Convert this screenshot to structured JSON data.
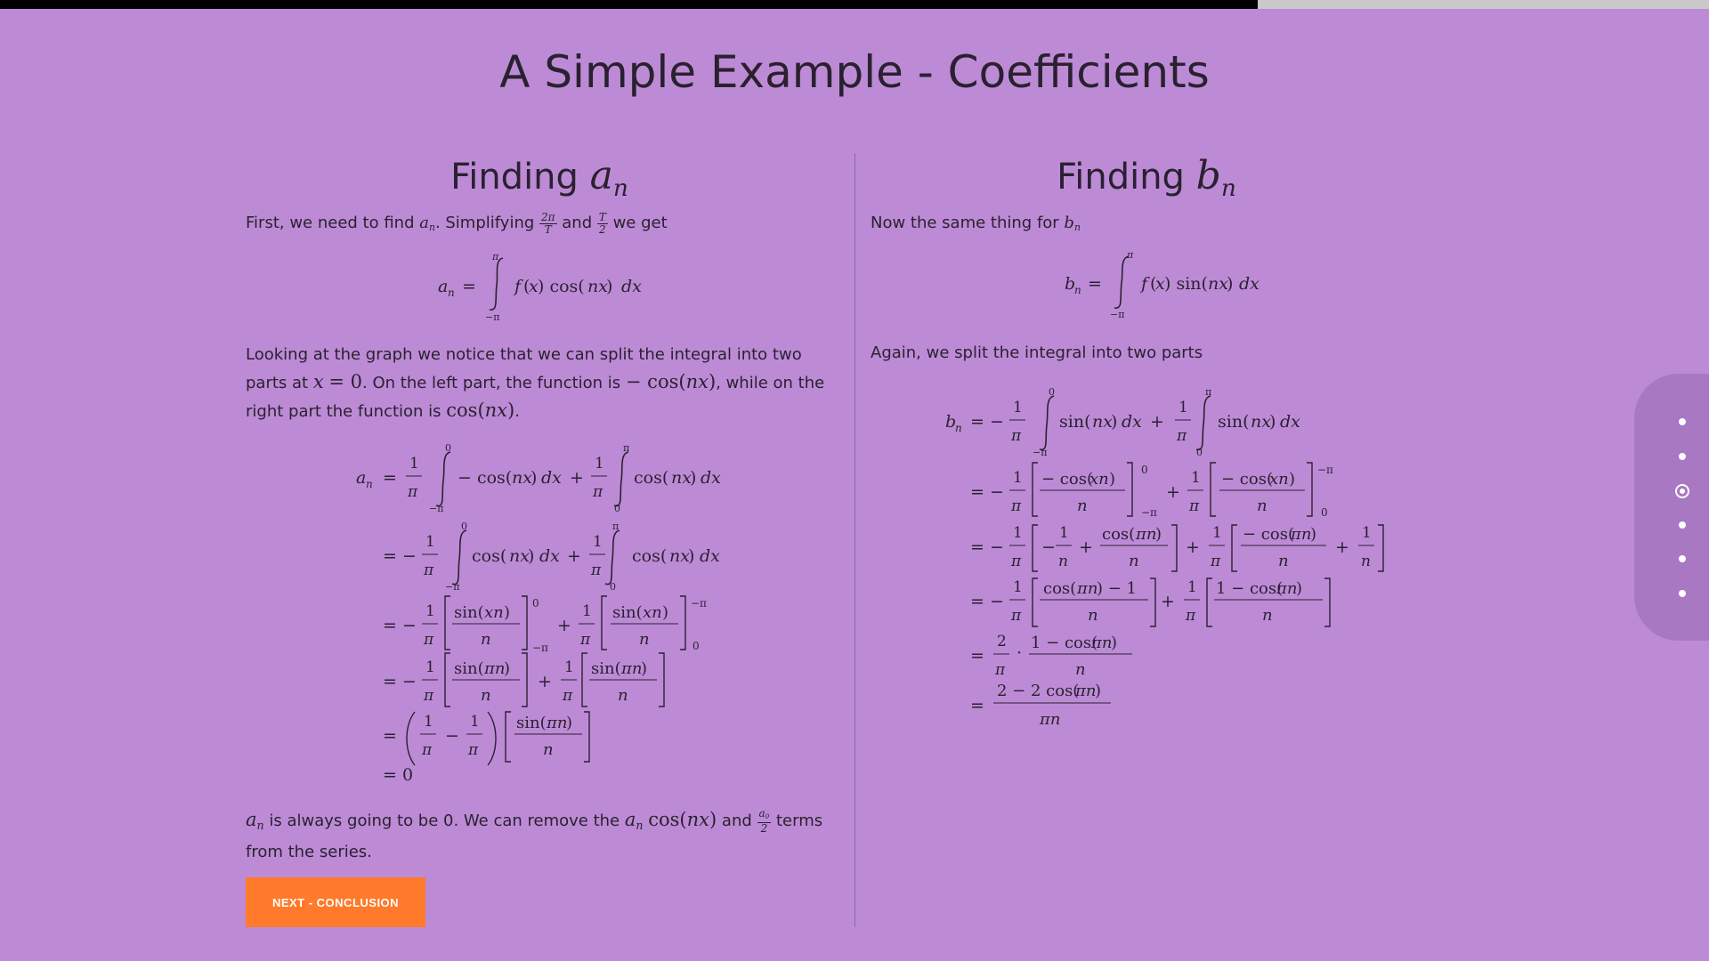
{
  "progress": {
    "fraction": 0.736
  },
  "title": "A Simple Example - Coefficients",
  "left": {
    "heading_prefix": "Finding",
    "heading_symbol": "a",
    "heading_sub": "n",
    "intro": "First, we need to find aₙ. Simplifying 2π/T and T/2 we get",
    "eq1": "aₙ = ∫₋π^π f(x) cos(nx) dx",
    "para2": "Looking at the graph we notice that we can split the integral into two parts at x = 0. On the left part, the function is − cos(nx), while on the right part the function is cos(nx).",
    "derivation": [
      "aₙ = (1/π) ∫₋π⁰ − cos(nx) dx + (1/π) ∫₀^π cos(nx) dx",
      "= −(1/π) ∫₋π⁰ cos(nx) dx + (1/π) ∫₀^π cos(nx) dx",
      "= −(1/π) [ sin(xn)/n ]₋π⁰ + (1/π) [ sin(xn)/n ]₀^−π",
      "= −(1/π) [ sin(πn)/n ] + (1/π) [ sin(πn)/n ]",
      "= ( 1/π − 1/π ) [ sin(πn)/n ]",
      "= 0"
    ],
    "conclusion": "aₙ is always going to be 0. We can remove the aₙ cos(nx) and a₀/2 terms from the series."
  },
  "right": {
    "heading_prefix": "Finding",
    "heading_symbol": "b",
    "heading_sub": "n",
    "intro": "Now the same thing for bₙ",
    "eq1": "bₙ = ∫₋π^π f(x) sin(nx) dx",
    "para2": "Again, we split the integral into two parts",
    "derivation": [
      "bₙ = −(1/π) ∫₋π⁰ sin(nx) dx + (1/π) ∫₀^π sin(nx) dx",
      "= −(1/π) [ − cos(xn)/n ]₋π⁰ + (1/π) [ − cos(xn)/n ]₀^−π",
      "= −(1/π) [ −1/n + cos(πn)/n ] + (1/π) [ − cos(πn)/n + 1/n ]",
      "= −(1/π) [ (cos(πn) − 1)/n ] + (1/π) [ (1 − cos(πn))/n ]",
      "= (2/π) · (1 − cos(πn))/n",
      "= (2 − 2 cos(πn)) / (πn)"
    ]
  },
  "button": {
    "label": "NEXT - CONCLUSION"
  },
  "nav": {
    "dot_count": 6,
    "active_index": 2
  },
  "colors": {
    "background": "#bd8bd6",
    "accent": "#ff7a2a",
    "nav_panel": "#a878c2"
  }
}
